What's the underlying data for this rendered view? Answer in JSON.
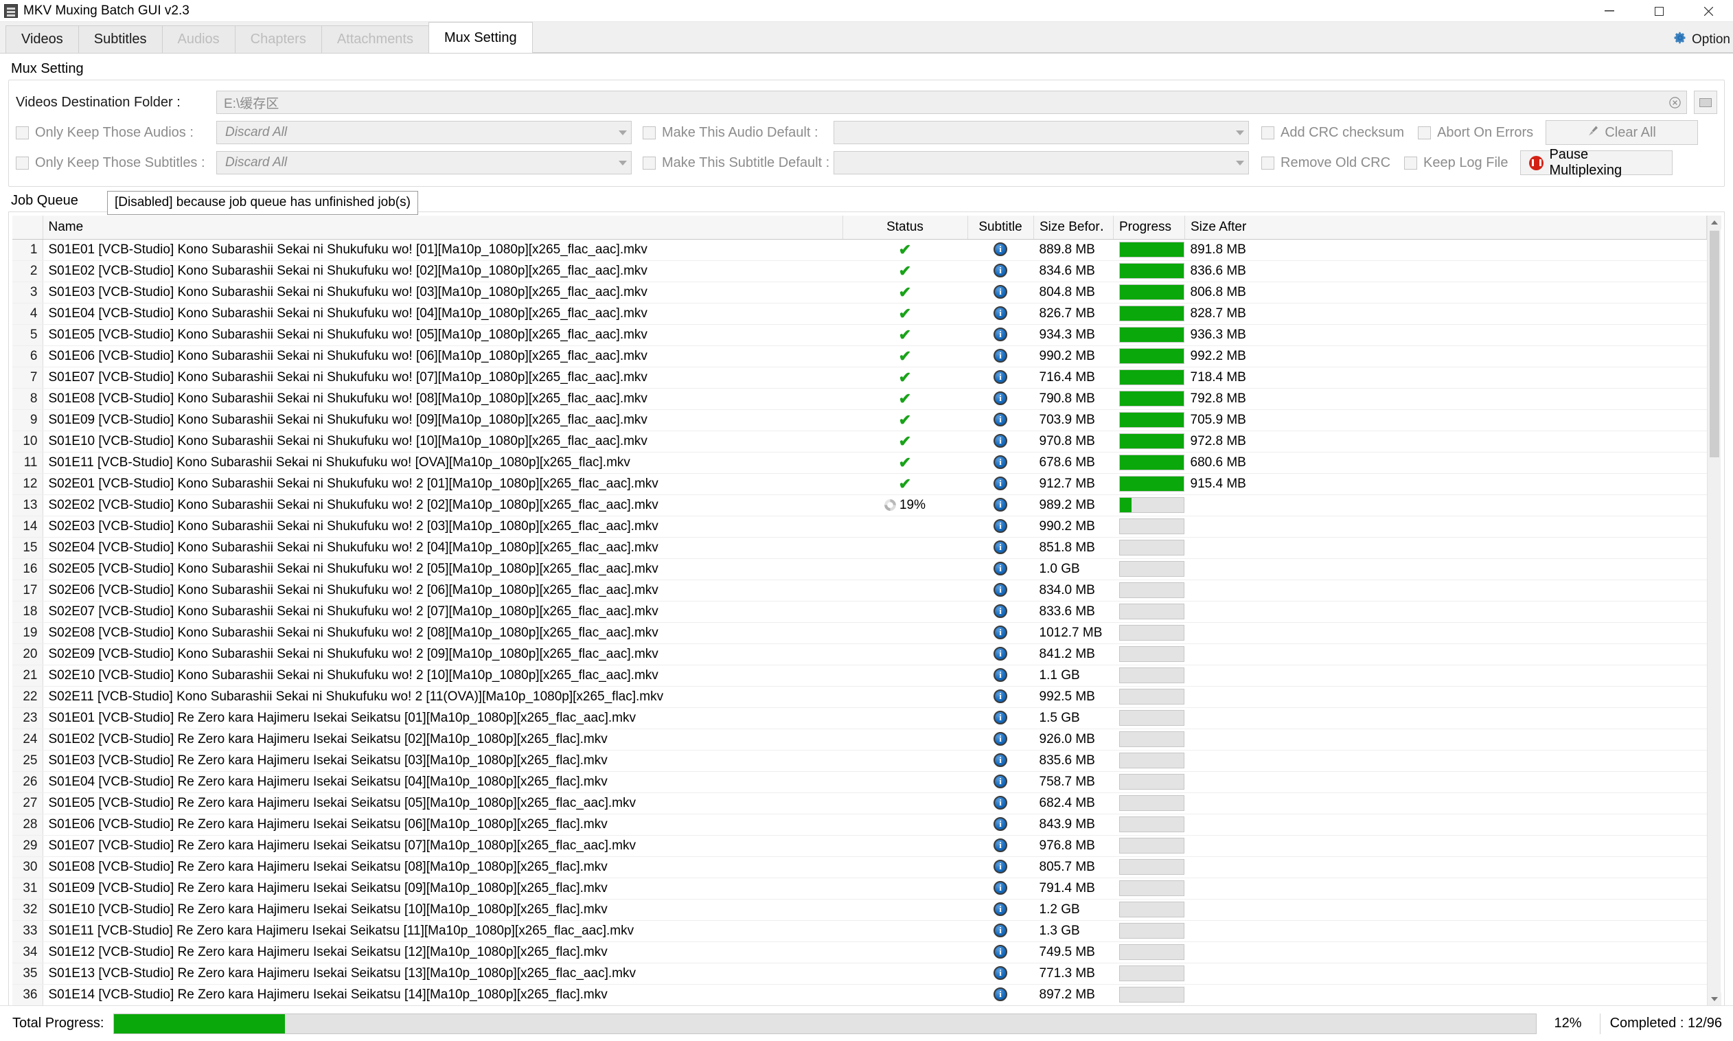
{
  "window": {
    "title": "MKV Muxing Batch GUI v2.3",
    "icon": "app-icon",
    "buttons": [
      {
        "name": "minimize",
        "glyph": "–"
      },
      {
        "name": "maximize",
        "glyph": "□"
      },
      {
        "name": "close",
        "glyph": "✕"
      }
    ]
  },
  "tabs": [
    {
      "label": "Videos",
      "state": "enabled"
    },
    {
      "label": "Subtitles",
      "state": "enabled"
    },
    {
      "label": "Audios",
      "state": "disabled"
    },
    {
      "label": "Chapters",
      "state": "disabled"
    },
    {
      "label": "Attachments",
      "state": "disabled"
    },
    {
      "label": "Mux Setting",
      "state": "active"
    }
  ],
  "options_button": {
    "label": "Option",
    "icon": "gear-icon"
  },
  "mux_setting": {
    "section_title": "Mux Setting",
    "destination": {
      "label": "Videos Destination Folder :",
      "value": "E:\\缓存区",
      "clear_icon": "clear-circle-icon",
      "browse_icon": "folder-icon"
    },
    "only_keep_audios": {
      "label": "Only Keep Those Audios :",
      "checked": false,
      "combo_value": "Discard All"
    },
    "only_keep_subtitles": {
      "label": "Only Keep Those Subtitles :",
      "checked": false,
      "combo_value": "Discard All"
    },
    "make_audio_default": {
      "label": "Make This Audio Default :",
      "checked": false,
      "combo_value": ""
    },
    "make_subtitle_default": {
      "label": "Make This Subtitle Default :",
      "checked": false,
      "combo_value": ""
    },
    "add_crc": {
      "label": "Add CRC checksum",
      "checked": false
    },
    "remove_old_crc": {
      "label": "Remove Old CRC",
      "checked": false
    },
    "abort_on_errors": {
      "label": "Abort On Errors",
      "checked": false
    },
    "keep_log_file": {
      "label": "Keep Log File",
      "checked": false
    },
    "clear_all": {
      "label": "Clear All",
      "icon": "broom-icon"
    },
    "pause": {
      "label": "Pause Multiplexing",
      "icon": "pause-icon"
    },
    "tooltip": "[Disabled] because job queue has unfinished job(s)"
  },
  "job_queue": {
    "section_title": "Job Queue",
    "columns": [
      "Name",
      "Status",
      "Subtitle",
      "Size Befor․",
      "Progress",
      "Size After"
    ],
    "rows": [
      {
        "n": "1",
        "name": "S01E01 [VCB-Studio] Kono Subarashii Sekai ni Shukufuku wo! [01][Ma10p_1080p][x265_flac_aac].mkv",
        "status": "done",
        "pct": 100,
        "subtitle_icon": "info-icon",
        "size_before": "889.8 MB",
        "size_after": "891.8 MB"
      },
      {
        "n": "2",
        "name": "S01E02 [VCB-Studio] Kono Subarashii Sekai ni Shukufuku wo! [02][Ma10p_1080p][x265_flac_aac].mkv",
        "status": "done",
        "pct": 100,
        "subtitle_icon": "info-icon",
        "size_before": "834.6 MB",
        "size_after": "836.6 MB"
      },
      {
        "n": "3",
        "name": "S01E03 [VCB-Studio] Kono Subarashii Sekai ni Shukufuku wo! [03][Ma10p_1080p][x265_flac_aac].mkv",
        "status": "done",
        "pct": 100,
        "subtitle_icon": "info-icon",
        "size_before": "804.8 MB",
        "size_after": "806.8 MB"
      },
      {
        "n": "4",
        "name": "S01E04 [VCB-Studio] Kono Subarashii Sekai ni Shukufuku wo! [04][Ma10p_1080p][x265_flac_aac].mkv",
        "status": "done",
        "pct": 100,
        "subtitle_icon": "info-icon",
        "size_before": "826.7 MB",
        "size_after": "828.7 MB"
      },
      {
        "n": "5",
        "name": "S01E05 [VCB-Studio] Kono Subarashii Sekai ni Shukufuku wo! [05][Ma10p_1080p][x265_flac_aac].mkv",
        "status": "done",
        "pct": 100,
        "subtitle_icon": "info-icon",
        "size_before": "934.3 MB",
        "size_after": "936.3 MB"
      },
      {
        "n": "6",
        "name": "S01E06 [VCB-Studio] Kono Subarashii Sekai ni Shukufuku wo! [06][Ma10p_1080p][x265_flac_aac].mkv",
        "status": "done",
        "pct": 100,
        "subtitle_icon": "info-icon",
        "size_before": "990.2 MB",
        "size_after": "992.2 MB"
      },
      {
        "n": "7",
        "name": "S01E07 [VCB-Studio] Kono Subarashii Sekai ni Shukufuku wo! [07][Ma10p_1080p][x265_flac_aac].mkv",
        "status": "done",
        "pct": 100,
        "subtitle_icon": "info-icon",
        "size_before": "716.4 MB",
        "size_after": "718.4 MB"
      },
      {
        "n": "8",
        "name": "S01E08 [VCB-Studio] Kono Subarashii Sekai ni Shukufuku wo! [08][Ma10p_1080p][x265_flac_aac].mkv",
        "status": "done",
        "pct": 100,
        "subtitle_icon": "info-icon",
        "size_before": "790.8 MB",
        "size_after": "792.8 MB"
      },
      {
        "n": "9",
        "name": "S01E09 [VCB-Studio] Kono Subarashii Sekai ni Shukufuku wo! [09][Ma10p_1080p][x265_flac_aac].mkv",
        "status": "done",
        "pct": 100,
        "subtitle_icon": "info-icon",
        "size_before": "703.9 MB",
        "size_after": "705.9 MB"
      },
      {
        "n": "10",
        "name": "S01E10 [VCB-Studio] Kono Subarashii Sekai ni Shukufuku wo! [10][Ma10p_1080p][x265_flac_aac].mkv",
        "status": "done",
        "pct": 100,
        "subtitle_icon": "info-icon",
        "size_before": "970.8 MB",
        "size_after": "972.8 MB"
      },
      {
        "n": "11",
        "name": "S01E11 [VCB-Studio] Kono Subarashii Sekai ni Shukufuku wo! [OVA][Ma10p_1080p][x265_flac].mkv",
        "status": "done",
        "pct": 100,
        "subtitle_icon": "info-icon",
        "size_before": "678.6 MB",
        "size_after": "680.6 MB"
      },
      {
        "n": "12",
        "name": "S02E01 [VCB-Studio] Kono Subarashii Sekai ni Shukufuku wo! 2 [01][Ma10p_1080p][x265_flac_aac].mkv",
        "status": "done",
        "pct": 100,
        "subtitle_icon": "info-icon",
        "size_before": "912.7 MB",
        "size_after": "915.4 MB"
      },
      {
        "n": "13",
        "name": "S02E02 [VCB-Studio] Kono Subarashii Sekai ni Shukufuku wo! 2 [02][Ma10p_1080p][x265_flac_aac].mkv",
        "status": "running",
        "status_text": "19%",
        "pct": 19,
        "subtitle_icon": "info-icon",
        "size_before": "989.2 MB",
        "size_after": ""
      },
      {
        "n": "14",
        "name": "S02E03 [VCB-Studio] Kono Subarashii Sekai ni Shukufuku wo! 2 [03][Ma10p_1080p][x265_flac_aac].mkv",
        "status": "pending",
        "pct": 0,
        "subtitle_icon": "info-icon",
        "size_before": "990.2 MB",
        "size_after": ""
      },
      {
        "n": "15",
        "name": "S02E04 [VCB-Studio] Kono Subarashii Sekai ni Shukufuku wo! 2 [04][Ma10p_1080p][x265_flac_aac].mkv",
        "status": "pending",
        "pct": 0,
        "subtitle_icon": "info-icon",
        "size_before": "851.8 MB",
        "size_after": ""
      },
      {
        "n": "16",
        "name": "S02E05 [VCB-Studio] Kono Subarashii Sekai ni Shukufuku wo! 2 [05][Ma10p_1080p][x265_flac_aac].mkv",
        "status": "pending",
        "pct": 0,
        "subtitle_icon": "info-icon",
        "size_before": "1.0 GB",
        "size_after": ""
      },
      {
        "n": "17",
        "name": "S02E06 [VCB-Studio] Kono Subarashii Sekai ni Shukufuku wo! 2 [06][Ma10p_1080p][x265_flac_aac].mkv",
        "status": "pending",
        "pct": 0,
        "subtitle_icon": "info-icon",
        "size_before": "834.0 MB",
        "size_after": ""
      },
      {
        "n": "18",
        "name": "S02E07 [VCB-Studio] Kono Subarashii Sekai ni Shukufuku wo! 2 [07][Ma10p_1080p][x265_flac_aac].mkv",
        "status": "pending",
        "pct": 0,
        "subtitle_icon": "info-icon",
        "size_before": "833.6 MB",
        "size_after": ""
      },
      {
        "n": "19",
        "name": "S02E08 [VCB-Studio] Kono Subarashii Sekai ni Shukufuku wo! 2 [08][Ma10p_1080p][x265_flac_aac].mkv",
        "status": "pending",
        "pct": 0,
        "subtitle_icon": "info-icon",
        "size_before": "1012.7 MB",
        "size_after": ""
      },
      {
        "n": "20",
        "name": "S02E09 [VCB-Studio] Kono Subarashii Sekai ni Shukufuku wo! 2 [09][Ma10p_1080p][x265_flac_aac].mkv",
        "status": "pending",
        "pct": 0,
        "subtitle_icon": "info-icon",
        "size_before": "841.2 MB",
        "size_after": ""
      },
      {
        "n": "21",
        "name": "S02E10 [VCB-Studio] Kono Subarashii Sekai ni Shukufuku wo! 2 [10][Ma10p_1080p][x265_flac_aac].mkv",
        "status": "pending",
        "pct": 0,
        "subtitle_icon": "info-icon",
        "size_before": "1.1 GB",
        "size_after": ""
      },
      {
        "n": "22",
        "name": "S02E11 [VCB-Studio] Kono Subarashii Sekai ni Shukufuku wo! 2 [11(OVA)][Ma10p_1080p][x265_flac].mkv",
        "status": "pending",
        "pct": 0,
        "subtitle_icon": "info-icon",
        "size_before": "992.5 MB",
        "size_after": ""
      },
      {
        "n": "23",
        "name": "S01E01 [VCB-Studio] Re Zero kara Hajimeru Isekai Seikatsu [01][Ma10p_1080p][x265_flac_aac].mkv",
        "status": "pending",
        "pct": 0,
        "subtitle_icon": "info-icon",
        "size_before": "1.5 GB",
        "size_after": ""
      },
      {
        "n": "24",
        "name": "S01E02 [VCB-Studio] Re Zero kara Hajimeru Isekai Seikatsu [02][Ma10p_1080p][x265_flac].mkv",
        "status": "pending",
        "pct": 0,
        "subtitle_icon": "info-icon",
        "size_before": "926.0 MB",
        "size_after": ""
      },
      {
        "n": "25",
        "name": "S01E03 [VCB-Studio] Re Zero kara Hajimeru Isekai Seikatsu [03][Ma10p_1080p][x265_flac].mkv",
        "status": "pending",
        "pct": 0,
        "subtitle_icon": "info-icon",
        "size_before": "835.6 MB",
        "size_after": ""
      },
      {
        "n": "26",
        "name": "S01E04 [VCB-Studio] Re Zero kara Hajimeru Isekai Seikatsu [04][Ma10p_1080p][x265_flac].mkv",
        "status": "pending",
        "pct": 0,
        "subtitle_icon": "info-icon",
        "size_before": "758.7 MB",
        "size_after": ""
      },
      {
        "n": "27",
        "name": "S01E05 [VCB-Studio] Re Zero kara Hajimeru Isekai Seikatsu [05][Ma10p_1080p][x265_flac_aac].mkv",
        "status": "pending",
        "pct": 0,
        "subtitle_icon": "info-icon",
        "size_before": "682.4 MB",
        "size_after": ""
      },
      {
        "n": "28",
        "name": "S01E06 [VCB-Studio] Re Zero kara Hajimeru Isekai Seikatsu [06][Ma10p_1080p][x265_flac].mkv",
        "status": "pending",
        "pct": 0,
        "subtitle_icon": "info-icon",
        "size_before": "843.9 MB",
        "size_after": ""
      },
      {
        "n": "29",
        "name": "S01E07 [VCB-Studio] Re Zero kara Hajimeru Isekai Seikatsu [07][Ma10p_1080p][x265_flac_aac].mkv",
        "status": "pending",
        "pct": 0,
        "subtitle_icon": "info-icon",
        "size_before": "976.8 MB",
        "size_after": ""
      },
      {
        "n": "30",
        "name": "S01E08 [VCB-Studio] Re Zero kara Hajimeru Isekai Seikatsu [08][Ma10p_1080p][x265_flac].mkv",
        "status": "pending",
        "pct": 0,
        "subtitle_icon": "info-icon",
        "size_before": "805.7 MB",
        "size_after": ""
      },
      {
        "n": "31",
        "name": "S01E09 [VCB-Studio] Re Zero kara Hajimeru Isekai Seikatsu [09][Ma10p_1080p][x265_flac].mkv",
        "status": "pending",
        "pct": 0,
        "subtitle_icon": "info-icon",
        "size_before": "791.4 MB",
        "size_after": ""
      },
      {
        "n": "32",
        "name": "S01E10 [VCB-Studio] Re Zero kara Hajimeru Isekai Seikatsu [10][Ma10p_1080p][x265_flac].mkv",
        "status": "pending",
        "pct": 0,
        "subtitle_icon": "info-icon",
        "size_before": "1.2 GB",
        "size_after": ""
      },
      {
        "n": "33",
        "name": "S01E11 [VCB-Studio] Re Zero kara Hajimeru Isekai Seikatsu [11][Ma10p_1080p][x265_flac_aac].mkv",
        "status": "pending",
        "pct": 0,
        "subtitle_icon": "info-icon",
        "size_before": "1.3 GB",
        "size_after": ""
      },
      {
        "n": "34",
        "name": "S01E12 [VCB-Studio] Re Zero kara Hajimeru Isekai Seikatsu [12][Ma10p_1080p][x265_flac].mkv",
        "status": "pending",
        "pct": 0,
        "subtitle_icon": "info-icon",
        "size_before": "749.5 MB",
        "size_after": ""
      },
      {
        "n": "35",
        "name": "S01E13 [VCB-Studio] Re Zero kara Hajimeru Isekai Seikatsu [13][Ma10p_1080p][x265_flac_aac].mkv",
        "status": "pending",
        "pct": 0,
        "subtitle_icon": "info-icon",
        "size_before": "771.3 MB",
        "size_after": ""
      },
      {
        "n": "36",
        "name": "S01E14 [VCB-Studio] Re Zero kara Hajimeru Isekai Seikatsu [14][Ma10p_1080p][x265_flac].mkv",
        "status": "pending",
        "pct": 0,
        "subtitle_icon": "info-icon",
        "size_before": "897.2 MB",
        "size_after": ""
      }
    ]
  },
  "status_bar": {
    "total_progress_label": "Total Progress:",
    "total_progress_pct": 12,
    "pct_label": "12%",
    "completed_label": "Completed : 12/96"
  },
  "colors": {
    "progress_green": "#0aa80a",
    "check_green": "#19a319",
    "pause_red": "#d32215"
  }
}
